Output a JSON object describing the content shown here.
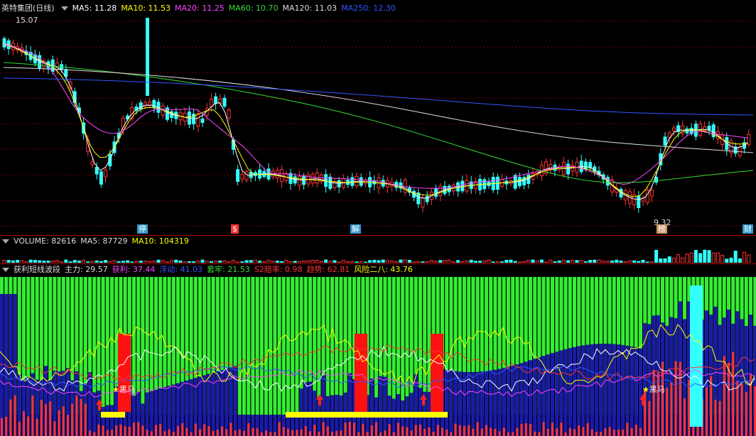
{
  "main": {
    "title": "英特集团(日线)",
    "indicators": [
      {
        "label": "MA5: 11.28",
        "color": "#ffffff"
      },
      {
        "label": "MA10: 11.53",
        "color": "#ffff00"
      },
      {
        "label": "MA20: 11.25",
        "color": "#ff44ff"
      },
      {
        "label": "MA60: 10.70",
        "color": "#33dd33"
      },
      {
        "label": "MA120: 11.03",
        "color": "#dddddd"
      },
      {
        "label": "MA250: 12.30",
        "color": "#3355ff"
      }
    ],
    "high_label": "15.07",
    "low_label": "9.32",
    "markers": [
      {
        "label": "停",
        "color": "#39c"
      },
      {
        "label": "$",
        "color": "#f33"
      },
      {
        "label": "解",
        "color": "#39c"
      },
      {
        "label": "榜",
        "color": "#c96"
      },
      {
        "label": "财",
        "color": "#39c"
      }
    ]
  },
  "volume": {
    "title": "VOLUME: 82616",
    "ma5": "MA5: 87729",
    "ma10": "MA10: 104319"
  },
  "indicator": {
    "title": "获利短线波段",
    "items": [
      {
        "label": "主力: 29.57",
        "color": "#dddddd"
      },
      {
        "label": "获利: 37.44",
        "color": "#ff44ff"
      },
      {
        "label": "浮动: 41.03",
        "color": "#3355ff"
      },
      {
        "label": "套牢: 21.53",
        "color": "#33dd33"
      },
      {
        "label": "S2赔率: 0.98",
        "color": "#ff3333"
      },
      {
        "label": "趋势: 62.81",
        "color": "#ff3333"
      },
      {
        "label": "风险二八: 43.76",
        "color": "#ffff00"
      }
    ],
    "signal_label": "黑马"
  },
  "colors": {
    "up": "#ff3333",
    "down": "#33ffff",
    "green": "#33ee33",
    "blue": "#1a1aaa",
    "yellow": "#ffff00",
    "grid": "#7a0000"
  }
}
